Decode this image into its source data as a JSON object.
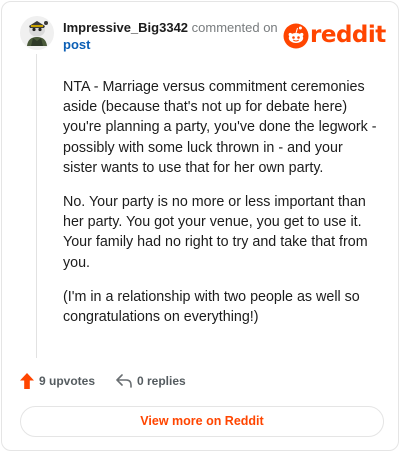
{
  "comment": {
    "username": "Impressive_Big3342",
    "commented_text": "commented on",
    "post_link": "post",
    "paragraphs": [
      "NTA - Marriage versus commitment ceremonies aside (because that's not up for debate here) you're planning a party, you've done the legwork - possibly with some luck thrown in - and your sister wants to use that for her own party.",
      "No. Your party is no more or less important than her party. You got your venue, you get to use it. Your family had no right to try and take that from you.",
      "(I'm in a relationship with two people as well so congratulations on everything!)"
    ]
  },
  "brand": {
    "name": "reddit",
    "logo_icon": "reddit-snoo-icon",
    "color": "#ff4500"
  },
  "actions": {
    "upvotes_label": "9 upvotes",
    "replies_label": "0 replies",
    "upvote_icon": "arrow-up-icon",
    "reply_icon": "reply-arrow-icon"
  },
  "footer": {
    "view_more_label": "View more on Reddit"
  }
}
